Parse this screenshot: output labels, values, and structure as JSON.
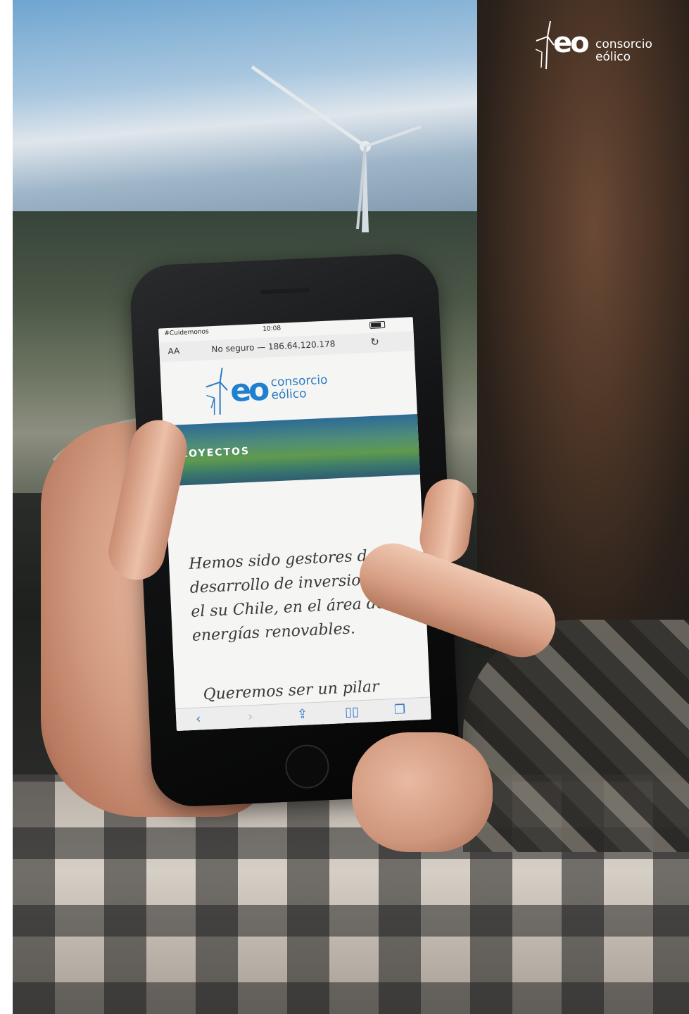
{
  "brand": {
    "mark": "eo",
    "line1": "consorcio",
    "line2": "eólico"
  },
  "phone": {
    "status": {
      "carrier": "#Cuidemonos",
      "time": "10:08"
    },
    "browser": {
      "text_size": "AA",
      "address": "No seguro — 186.64.120.178",
      "reload_icon": "reload-icon"
    },
    "site": {
      "logo_mark": "eo",
      "logo_line1": "consorcio",
      "logo_line2": "eólico",
      "hero_title": "PROYECTOS",
      "paragraph1": "Hemos sido gestores del desarrollo de inversiones en el su Chile, en el área de energías renovables.",
      "paragraph2": "Queremos ser un pilar"
    },
    "toolbar": {
      "back": "‹",
      "forward": "›",
      "share": "⇪",
      "bookmarks": "▯▯",
      "tabs": "❐"
    }
  },
  "colors": {
    "brand_blue": "#1f7fd0",
    "link_blue": "#3478d0"
  }
}
